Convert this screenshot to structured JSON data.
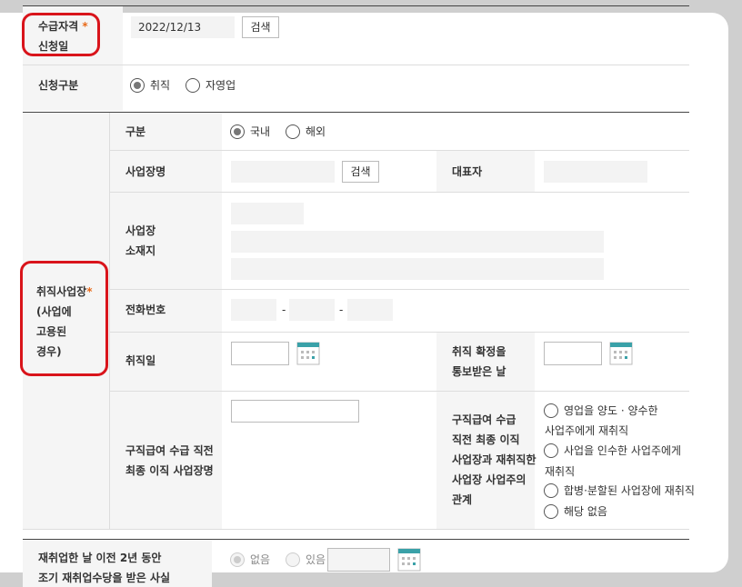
{
  "qualification": {
    "label_line1": "수급자격",
    "label_line2": "신청일",
    "star": "*",
    "date_value": "2022/12/13",
    "search_label": "검색"
  },
  "application_type": {
    "label": "신청구분",
    "options": [
      "취직",
      "자영업"
    ],
    "selected": "취직"
  },
  "employment": {
    "label_line1": "취직사업장",
    "star": "*",
    "label_line2": "(사업에",
    "label_line3": "고용된",
    "label_line4": "경우)",
    "division": {
      "label": "구분",
      "options": [
        "국내",
        "해외"
      ],
      "selected": "국내"
    },
    "business_name": {
      "label": "사업장명",
      "search_label": "검색"
    },
    "representative": {
      "label": "대표자"
    },
    "address": {
      "label_line1": "사업장",
      "label_line2": "소재지"
    },
    "phone": {
      "label": "전화번호",
      "sep1": "-",
      "sep2": "-"
    },
    "employment_date": {
      "label": "취직일"
    },
    "notice_date": {
      "label_line1": "취직 확정을",
      "label_line2": "통보받은 날"
    },
    "last_employer": {
      "label_line1": "구직급여 수급 직전",
      "label_line2": "최종 이직 사업장명"
    },
    "relation": {
      "label_line1": "구직급여 수급",
      "label_line2": "직전 최종 이직",
      "label_line3": "사업장과 재취직한",
      "label_line4": "사업장 사업주의",
      "label_line5": "관계",
      "option1_line1": "영업을 양도 · 양수한",
      "option1_line2": "사업주에게 재취직",
      "option2_line1": "사업을 인수한 사업주에게",
      "option2_line2": "재취직",
      "option3": "합병·분할된 사업장에 재취직",
      "option4": "해당 없음"
    }
  },
  "early_allowance": {
    "label_line1": "재취업한 날 이전 2년 동안",
    "label_line2": "조기 재취업수당을 받은 사실",
    "options": [
      "없음",
      "있음"
    ],
    "selected": "없음"
  },
  "colors": {
    "highlight": "#d9141b",
    "star": "#e86a1a",
    "calendar_accent": "#3aa1a8"
  }
}
